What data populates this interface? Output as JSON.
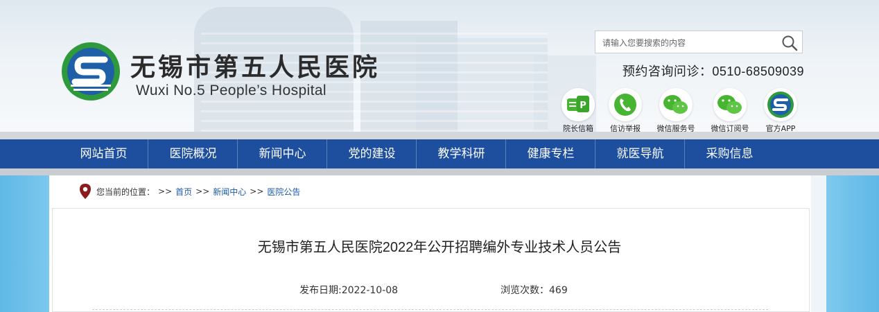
{
  "header": {
    "title_cn": "无锡市第五人民医院",
    "title_en": "Wuxi No.5 People’s Hospital",
    "search_placeholder": "请输入您要搜索的内容",
    "hotline_label": "预约咨询问诊：",
    "hotline_number": "0510-68509039",
    "quick_links": [
      {
        "label": "院长信箱",
        "icon": "mailbox-icon"
      },
      {
        "label": "信访举报",
        "icon": "phone-icon"
      },
      {
        "label": "微信服务号",
        "icon": "wechat-icon"
      },
      {
        "label": "微信订阅号",
        "icon": "wechat-icon"
      },
      {
        "label": "官方APP",
        "icon": "hospital-logo-icon"
      }
    ]
  },
  "nav": {
    "items": [
      "网站首页",
      "医院概况",
      "新闻中心",
      "党的建设",
      "教学科研",
      "健康专栏",
      "就医导航",
      "采购信息"
    ]
  },
  "breadcrumb": {
    "prefix": "您当前的位置：",
    "sep": ">>",
    "items": [
      "首页",
      "新闻中心",
      "医院公告"
    ]
  },
  "article": {
    "title": "无锡市第五人民医院2022年公开招聘编外专业技术人员公告",
    "publish_date": "发布日期:2022-10-08",
    "views": "浏览次数：469"
  },
  "colors": {
    "nav_blue": "#1d4f9e",
    "link_blue": "#1d5aa8",
    "logo_green": "#2e9a3c",
    "logo_blue": "#1f5fa8",
    "wechat_green": "#48b532"
  }
}
